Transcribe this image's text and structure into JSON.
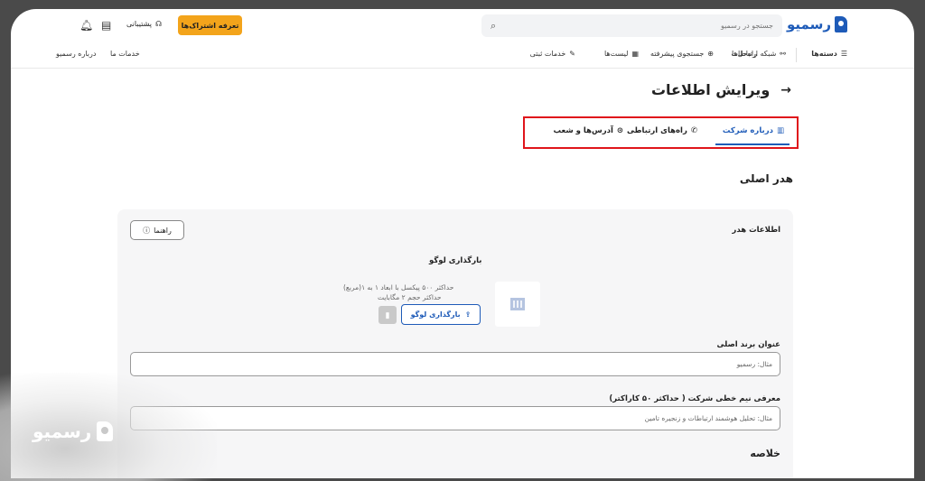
{
  "header": {
    "brand": "رسمیو",
    "search_placeholder": "جستجو در رسمیو",
    "cta_label": "تعرفه اشتراک‌ها",
    "support_label": "پشتیبانی"
  },
  "nav": {
    "categories": "دسته‌ها",
    "network": "شبکه ارتباطات",
    "advanced_search": "جستجوی پیشرفته",
    "lists": "لیست‌ها",
    "registration": "خدمات ثبتی",
    "solutions": "راه‌حل‌ها",
    "services": "خدمات ما",
    "about": "درباره رسمیو"
  },
  "page": {
    "title": "ویرایش اطلاعات",
    "tabs": [
      {
        "label": "درباره شرکت",
        "icon": "building-icon"
      },
      {
        "label": "راه‌های ارتباطی",
        "icon": "phone-icon"
      },
      {
        "label": "آدرس‌ها و شعب",
        "icon": "location-pin-icon"
      }
    ],
    "section_title": "هدر اصلی"
  },
  "card": {
    "title": "اطلاعات هدر",
    "guide_label": "راهنما",
    "upload_title": "بارگذاری لوگو",
    "hint_1": "حداکثر ۵۰۰ پیکسل با ابعاد ۱ به ۱(مربع)",
    "hint_2": "حداکثر حجم ۲ مگابایت",
    "upload_label": "بارگذاری لوگو",
    "brand_label": "عنوان برند اصلی",
    "brand_placeholder": "مثال: رسمیو",
    "intro_label": "معرفی نیم خطی شرکت ( حداکثر ۵۰ کاراکتر)",
    "intro_placeholder": "مثال: تحلیل هوشمند ارتباطات و زنجیره تامین",
    "summary_label": "خلاصه"
  },
  "watermark": {
    "brand": "رسمیو"
  },
  "colors": {
    "accent": "#1e5bb8",
    "cta": "#f3a41b",
    "highlight": "#e0151b"
  }
}
